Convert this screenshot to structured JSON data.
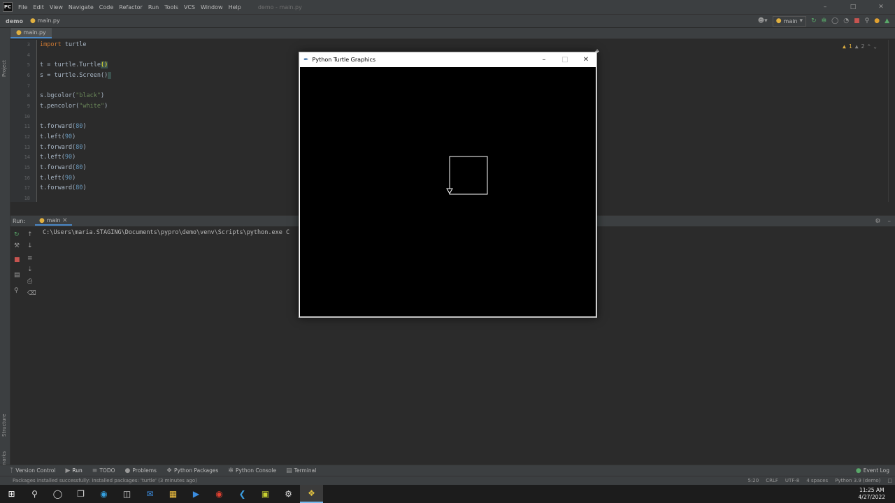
{
  "menubar": {
    "logo_text": "PC",
    "items": [
      "File",
      "Edit",
      "View",
      "Navigate",
      "Code",
      "Refactor",
      "Run",
      "Tools",
      "VCS",
      "Window",
      "Help"
    ],
    "project_title": "demo - main.py"
  },
  "navbar": {
    "project": "demo",
    "file": "main.py",
    "run_config": "main"
  },
  "tab": {
    "label": "main.py"
  },
  "left_strip": {
    "project": "Project",
    "structure": "Structure",
    "bookmarks": "Bookmarks"
  },
  "editor": {
    "inspections": {
      "warnings": "1",
      "weak_warnings": "2"
    },
    "lines": [
      {
        "num": "3",
        "code": "import turtle"
      },
      {
        "num": "4",
        "code": ""
      },
      {
        "num": "5",
        "code": "t = turtle.Turtle()"
      },
      {
        "num": "6",
        "code": "s = turtle.Screen()"
      },
      {
        "num": "7",
        "code": ""
      },
      {
        "num": "8",
        "code": "s.bgcolor(\"black\")"
      },
      {
        "num": "9",
        "code": "t.pencolor(\"white\")"
      },
      {
        "num": "10",
        "code": ""
      },
      {
        "num": "11",
        "code": "t.forward(80)"
      },
      {
        "num": "12",
        "code": "t.left(90)"
      },
      {
        "num": "13",
        "code": "t.forward(80)"
      },
      {
        "num": "14",
        "code": "t.left(90)"
      },
      {
        "num": "15",
        "code": "t.forward(80)"
      },
      {
        "num": "16",
        "code": "t.left(90)"
      },
      {
        "num": "17",
        "code": "t.forward(80)"
      },
      {
        "num": "18",
        "code": ""
      }
    ]
  },
  "run_panel": {
    "label": "Run:",
    "tab": "main",
    "output": "C:\\Users\\maria.STAGING\\Documents\\pypro\\demo\\venv\\Scripts\\python.exe C"
  },
  "bottom_tabs": {
    "version_control": "Version Control",
    "run": "Run",
    "todo": "TODO",
    "problems": "Problems",
    "python_packages": "Python Packages",
    "python_console": "Python Console",
    "terminal": "Terminal",
    "event_log": "Event Log"
  },
  "status": {
    "message": "Packages installed successfully: Installed packages: 'turtle' (3 minutes ago)",
    "position": "5:20",
    "line_sep": "CRLF",
    "encoding": "UTF-8",
    "indent": "4 spaces",
    "interpreter": "Python 3.9 (demo)"
  },
  "turtle_window": {
    "title": "Python Turtle Graphics",
    "canvas_bg": "#000000",
    "pen_color": "#ffffff",
    "square_side": 80
  },
  "taskbar": {
    "icons": [
      "windows-icon",
      "search-icon",
      "cortana-icon",
      "task-view-icon",
      "edge-icon",
      "store-icon",
      "mail-icon",
      "explorer-icon",
      "media-icon",
      "chrome-icon",
      "vscode-icon",
      "pycharm-icon",
      "settings-icon",
      "python-icon"
    ],
    "time": "11:25 AM",
    "date": "4/27/2022"
  }
}
